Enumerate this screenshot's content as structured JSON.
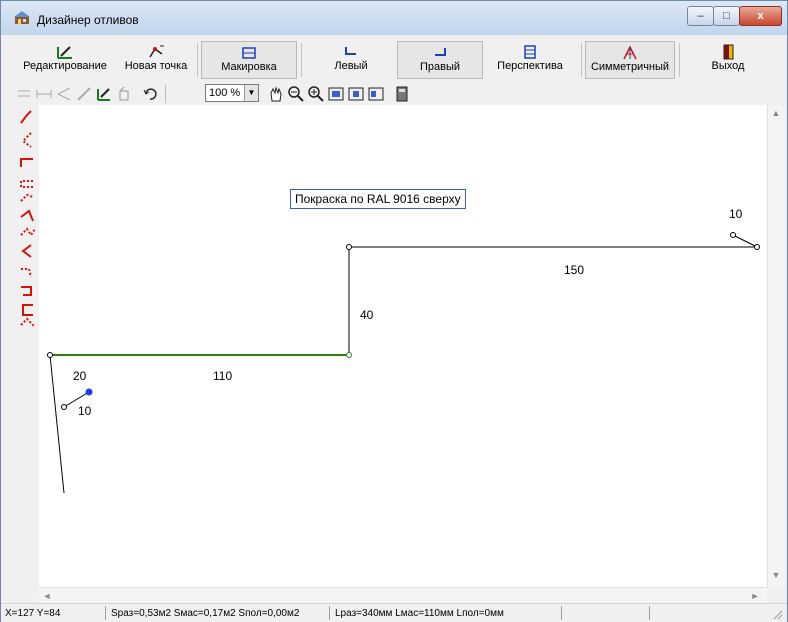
{
  "window": {
    "title": "Дизайнер отливов",
    "controls": {
      "minimize": "–",
      "maximize": "□",
      "close": "x"
    }
  },
  "toolbar": {
    "buttons": [
      {
        "label": "Редактирование",
        "icon": "edit-ruler-icon",
        "pressed": false
      },
      {
        "label": "Новая точка",
        "icon": "new-point-icon",
        "pressed": false
      },
      {
        "label": "Макировка",
        "icon": "layout-icon",
        "pressed": true
      },
      {
        "label": "Левый",
        "icon": "left-drip-icon",
        "pressed": false
      },
      {
        "label": "Правый",
        "icon": "right-drip-icon",
        "pressed": true
      },
      {
        "label": "Перспектива",
        "icon": "perspective-icon",
        "pressed": false
      },
      {
        "label": "Симметричный",
        "icon": "symmetric-icon",
        "pressed": true
      },
      {
        "label": "Выход",
        "icon": "exit-door-icon",
        "pressed": false
      }
    ]
  },
  "toolbar2": {
    "zoom": "100 %",
    "icons": [
      "align-icon",
      "dimension-icon",
      "angle-icon",
      "pen-icon",
      "edit-ruler-icon",
      "paint-bucket-icon",
      "undo-icon",
      "hand-pan-icon",
      "zoom-out-icon",
      "zoom-in-icon",
      "fit-icon",
      "page-icon",
      "page-width-icon",
      "calculator-icon"
    ]
  },
  "drawing": {
    "note": "Покраска по RAL 9016 сверху",
    "dimensions": [
      "10",
      "150",
      "40",
      "20",
      "110",
      "10"
    ],
    "colors": {
      "profile": "#000000",
      "highlight": "#2e7d12",
      "point": "#1f3cf0",
      "palette": "#d4140c"
    }
  },
  "statusbar": {
    "coords": "X=127  Y=84",
    "areas": "Sраз=0,53м2  Sмас=0,17м2  Sпол=0,00м2",
    "lengths": "Lраз=340мм  Lмас=110мм  Lпол=0мм"
  }
}
